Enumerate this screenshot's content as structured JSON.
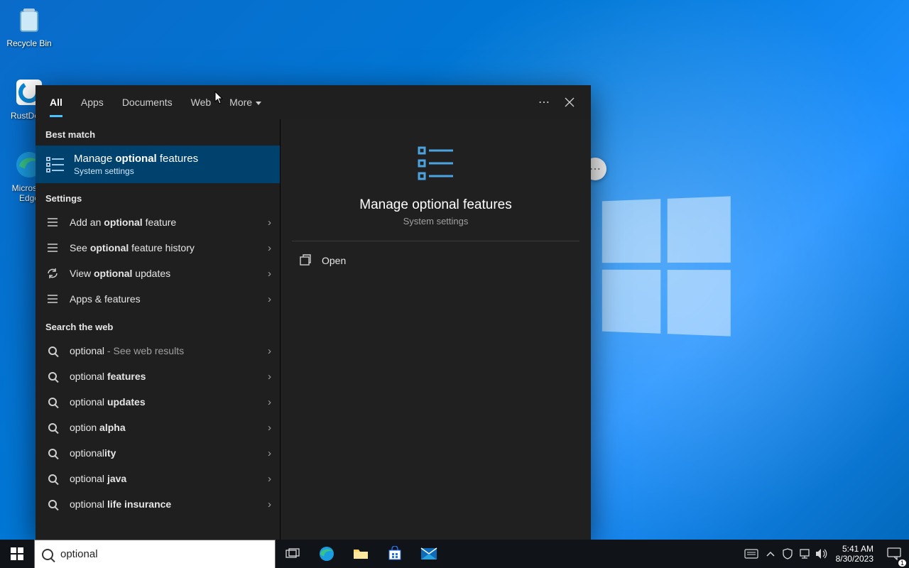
{
  "desktop": {
    "icons": [
      {
        "name": "recycle-bin",
        "label": "Recycle Bin"
      },
      {
        "name": "rustdesk",
        "label": "RustDesk"
      },
      {
        "name": "edge",
        "label": "Microsoft Edge"
      }
    ]
  },
  "search": {
    "query": "optional",
    "tabs": [
      "All",
      "Apps",
      "Documents",
      "Web",
      "More"
    ],
    "active_tab": "All",
    "groups": {
      "best_match_label": "Best match",
      "best_match": {
        "title_pre": "Manage ",
        "title_bold": "optional",
        "title_post": " features",
        "subtitle": "System settings"
      },
      "settings_label": "Settings",
      "settings": [
        {
          "pre": "Add an ",
          "bold": "optional",
          "post": " feature"
        },
        {
          "pre": "See ",
          "bold": "optional",
          "post": " feature history"
        },
        {
          "pre": "View ",
          "bold": "optional",
          "post": " updates"
        },
        {
          "pre": "",
          "bold": "",
          "post": "Apps & features"
        }
      ],
      "web_label": "Search the web",
      "web": [
        {
          "pre": "optional",
          "bold": "",
          "post": " - See web results",
          "dim_post": true
        },
        {
          "pre": "optional ",
          "bold": "features",
          "post": ""
        },
        {
          "pre": "optional ",
          "bold": "updates",
          "post": ""
        },
        {
          "pre": "option ",
          "bold": "alpha",
          "post": ""
        },
        {
          "pre": "optional",
          "bold": "ity",
          "post": ""
        },
        {
          "pre": "optional ",
          "bold": "java",
          "post": ""
        },
        {
          "pre": "optional ",
          "bold": "life insurance",
          "post": ""
        }
      ]
    },
    "detail": {
      "title": "Manage optional features",
      "subtitle": "System settings",
      "actions": [
        "Open"
      ]
    }
  },
  "taskbar": {
    "time": "5:41 AM",
    "date": "8/30/2023",
    "notif_count": "1"
  }
}
